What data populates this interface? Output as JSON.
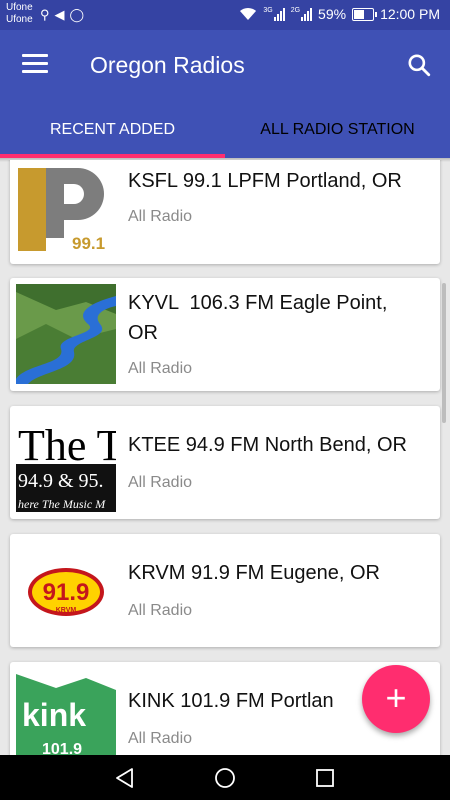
{
  "status_bar": {
    "carrier_1": "Ufone",
    "carrier_2": "Ufone",
    "battery": "59%",
    "time": "12:00 PM",
    "battery_level": 0.59,
    "net_1": "3G",
    "net_2": "2G"
  },
  "app_bar": {
    "title": "Oregon Radios"
  },
  "tabs": [
    {
      "label": "RECENT ADDED",
      "selected": true
    },
    {
      "label": "ALL RADIO STATION",
      "selected": false
    }
  ],
  "stations": [
    {
      "name": "KSFL 99.1 LPFM Portland, OR",
      "category": "All Radio",
      "logo_text": "99.1"
    },
    {
      "name": "KYVL  106.3 FM Eagle Point,\nOR",
      "category": "All Radio"
    },
    {
      "name": "KTEE 94.9 FM North Bend, OR",
      "category": "All Radio",
      "logo_text": "The T",
      "logo_text_2": "94.9 & 95.",
      "logo_text_3": "here The Music M"
    },
    {
      "name": "KRVM 91.9 FM Eugene, OR",
      "category": "All Radio",
      "logo_text": "91.9",
      "logo_text_2": "KRVM"
    },
    {
      "name": "KINK 101.9 FM Portlan",
      "category": "All Radio",
      "logo_text": "kink",
      "logo_text_2": "101.9"
    }
  ],
  "fab": {
    "label": "+"
  },
  "colors": {
    "primary": "#3f51b5",
    "accent": "#ff2d6f"
  }
}
